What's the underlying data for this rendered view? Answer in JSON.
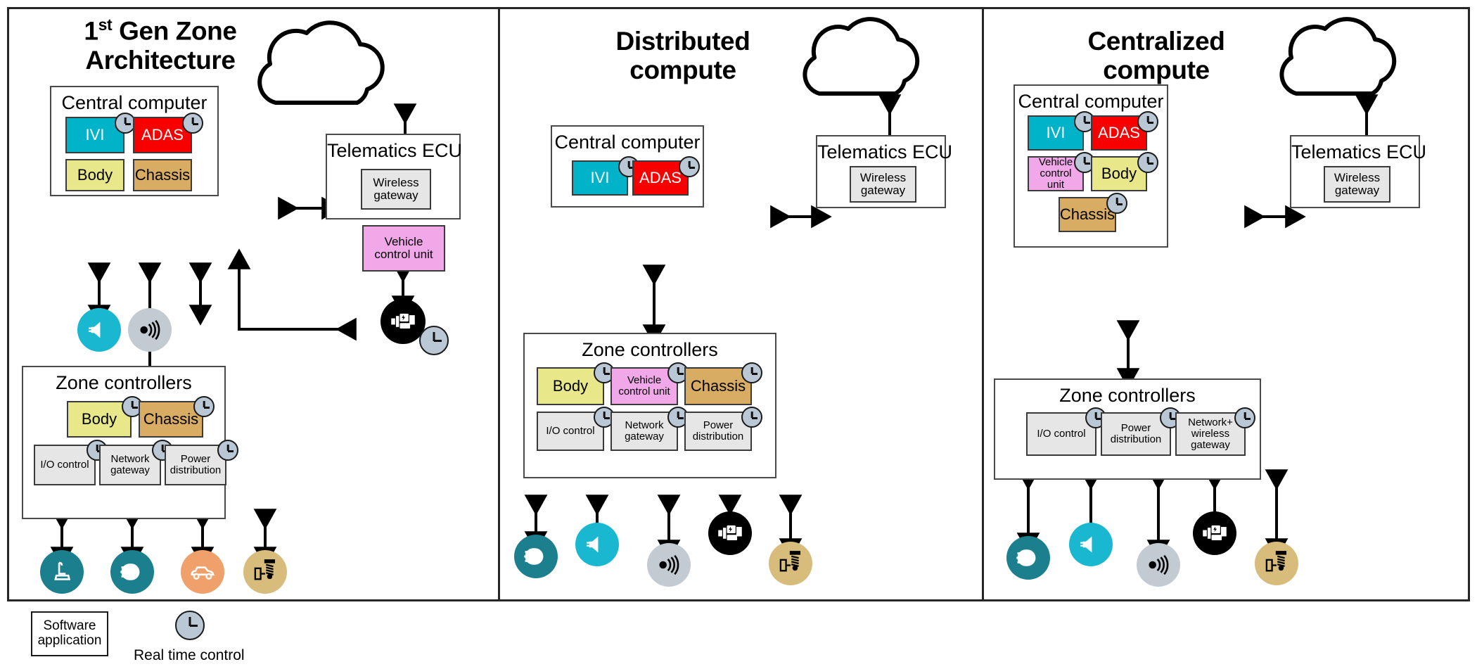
{
  "legend": {
    "software_application": "Software\napplication",
    "real_time_control": "Real time control",
    "clock_icon": "clock-icon"
  },
  "colors": {
    "ivi": "#00b3c8",
    "adas": "#f90000",
    "body": "#e8e88a",
    "chassis": "#d8ac63",
    "vehicle_control_unit": "#f0a8e8",
    "generic_gray": "#e6e6e6",
    "clock_badge": "#b9c8d4",
    "teal": "#1b7f8e",
    "cyan": "#19b8d0",
    "orange": "#f0a06a",
    "tan": "#d7bc7c",
    "silver": "#c2cad2",
    "black": "#000000",
    "frame": "#262626"
  },
  "panels": [
    {
      "id": "panel-1st-gen-zone-architecture",
      "title_line1": "1st Gen Zone",
      "title_line1_main": "1",
      "title_line1_sup": "st",
      "title_line1_rest": " Gen Zone",
      "title_line2": "Architecture",
      "cloud": "cloud-icon",
      "central_computer": {
        "label": "Central computer",
        "chips": [
          {
            "label": "IVI",
            "color": "ivi",
            "text": "white",
            "clock": true
          },
          {
            "label": "ADAS",
            "color": "adas",
            "text": "white",
            "clock": true
          },
          {
            "label": "Body",
            "color": "body",
            "text": "dark",
            "clock": false
          },
          {
            "label": "Chassis",
            "color": "chassis",
            "text": "dark",
            "clock": false
          }
        ]
      },
      "telematics_ecu": {
        "label": "Telematics ECU",
        "chips": [
          {
            "label": "Wireless\ngateway",
            "color": "generic_gray"
          }
        ]
      },
      "vehicle_control_unit": {
        "label": "Vehicle\ncontrol unit",
        "color": "vehicle_control_unit"
      },
      "zone_controllers": {
        "label": "Zone controllers",
        "chips": [
          {
            "label": "Body",
            "color": "body",
            "clock": true
          },
          {
            "label": "Chassis",
            "color": "chassis",
            "clock": true
          },
          {
            "label": "I/O control",
            "color": "generic_gray",
            "clock": true
          },
          {
            "label": "Network\ngateway",
            "color": "generic_gray",
            "clock": true
          },
          {
            "label": "Power\ndistribution",
            "color": "generic_gray",
            "clock": true
          }
        ]
      },
      "mid_icons": [
        {
          "name": "speaker-icon",
          "color": "cyan"
        },
        {
          "name": "radar-sensor-icon",
          "color": "silver"
        }
      ],
      "vcu_icon": {
        "name": "motor-icon",
        "color": "black",
        "clock": true
      },
      "bottom_icons": [
        {
          "name": "seat-icon",
          "color": "teal"
        },
        {
          "name": "headlight-icon",
          "color": "teal"
        },
        {
          "name": "car-body-icon",
          "color": "orange"
        },
        {
          "name": "suspension-icon",
          "color": "tan"
        }
      ]
    },
    {
      "id": "panel-distributed-compute",
      "title_line1": "Distributed",
      "title_line2": "compute",
      "cloud": "cloud-icon",
      "central_computer": {
        "label": "Central computer",
        "chips": [
          {
            "label": "IVI",
            "color": "ivi",
            "text": "white",
            "clock": true
          },
          {
            "label": "ADAS",
            "color": "adas",
            "text": "white",
            "clock": true
          }
        ]
      },
      "telematics_ecu": {
        "label": "Telematics ECU",
        "chips": [
          {
            "label": "Wireless\ngateway",
            "color": "generic_gray"
          }
        ]
      },
      "zone_controllers": {
        "label": "Zone controllers",
        "chips": [
          {
            "label": "Body",
            "color": "body",
            "clock": true
          },
          {
            "label": "Vehicle\ncontrol unit",
            "color": "vehicle_control_unit",
            "clock": true
          },
          {
            "label": "Chassis",
            "color": "chassis",
            "clock": true
          },
          {
            "label": "I/O control",
            "color": "generic_gray",
            "clock": true
          },
          {
            "label": "Network\ngateway",
            "color": "generic_gray",
            "clock": true
          },
          {
            "label": "Power\ndistribution",
            "color": "generic_gray",
            "clock": true
          }
        ]
      },
      "bottom_icons": [
        {
          "name": "headlight-icon",
          "color": "teal"
        },
        {
          "name": "speaker-icon",
          "color": "cyan"
        },
        {
          "name": "radar-sensor-icon",
          "color": "silver"
        },
        {
          "name": "motor-icon",
          "color": "black"
        },
        {
          "name": "suspension-icon",
          "color": "tan"
        }
      ]
    },
    {
      "id": "panel-centralized-compute",
      "title_line1": "Centralized",
      "title_line2": "compute",
      "cloud": "cloud-icon",
      "central_computer": {
        "label": "Central computer",
        "chips": [
          {
            "label": "IVI",
            "color": "ivi",
            "text": "white",
            "clock": true
          },
          {
            "label": "ADAS",
            "color": "adas",
            "text": "white",
            "clock": true
          },
          {
            "label": "Vehicle\ncontrol unit",
            "color": "vehicle_control_unit",
            "clock": true
          },
          {
            "label": "Body",
            "color": "body",
            "clock": true
          },
          {
            "label": "Chassis",
            "color": "chassis",
            "clock": true
          }
        ]
      },
      "telematics_ecu": {
        "label": "Telematics ECU",
        "chips": [
          {
            "label": "Wireless\ngateway",
            "color": "generic_gray"
          }
        ]
      },
      "zone_controllers": {
        "label": "Zone controllers",
        "chips": [
          {
            "label": "I/O control",
            "color": "generic_gray",
            "clock": true
          },
          {
            "label": "Power\ndistribution",
            "color": "generic_gray",
            "clock": true
          },
          {
            "label": "Network+\nwireless\ngateway",
            "color": "generic_gray",
            "clock": true
          }
        ]
      },
      "bottom_icons": [
        {
          "name": "headlight-icon",
          "color": "teal"
        },
        {
          "name": "speaker-icon",
          "color": "cyan"
        },
        {
          "name": "radar-sensor-icon",
          "color": "silver"
        },
        {
          "name": "motor-icon",
          "color": "black"
        },
        {
          "name": "suspension-icon",
          "color": "tan"
        }
      ]
    }
  ]
}
